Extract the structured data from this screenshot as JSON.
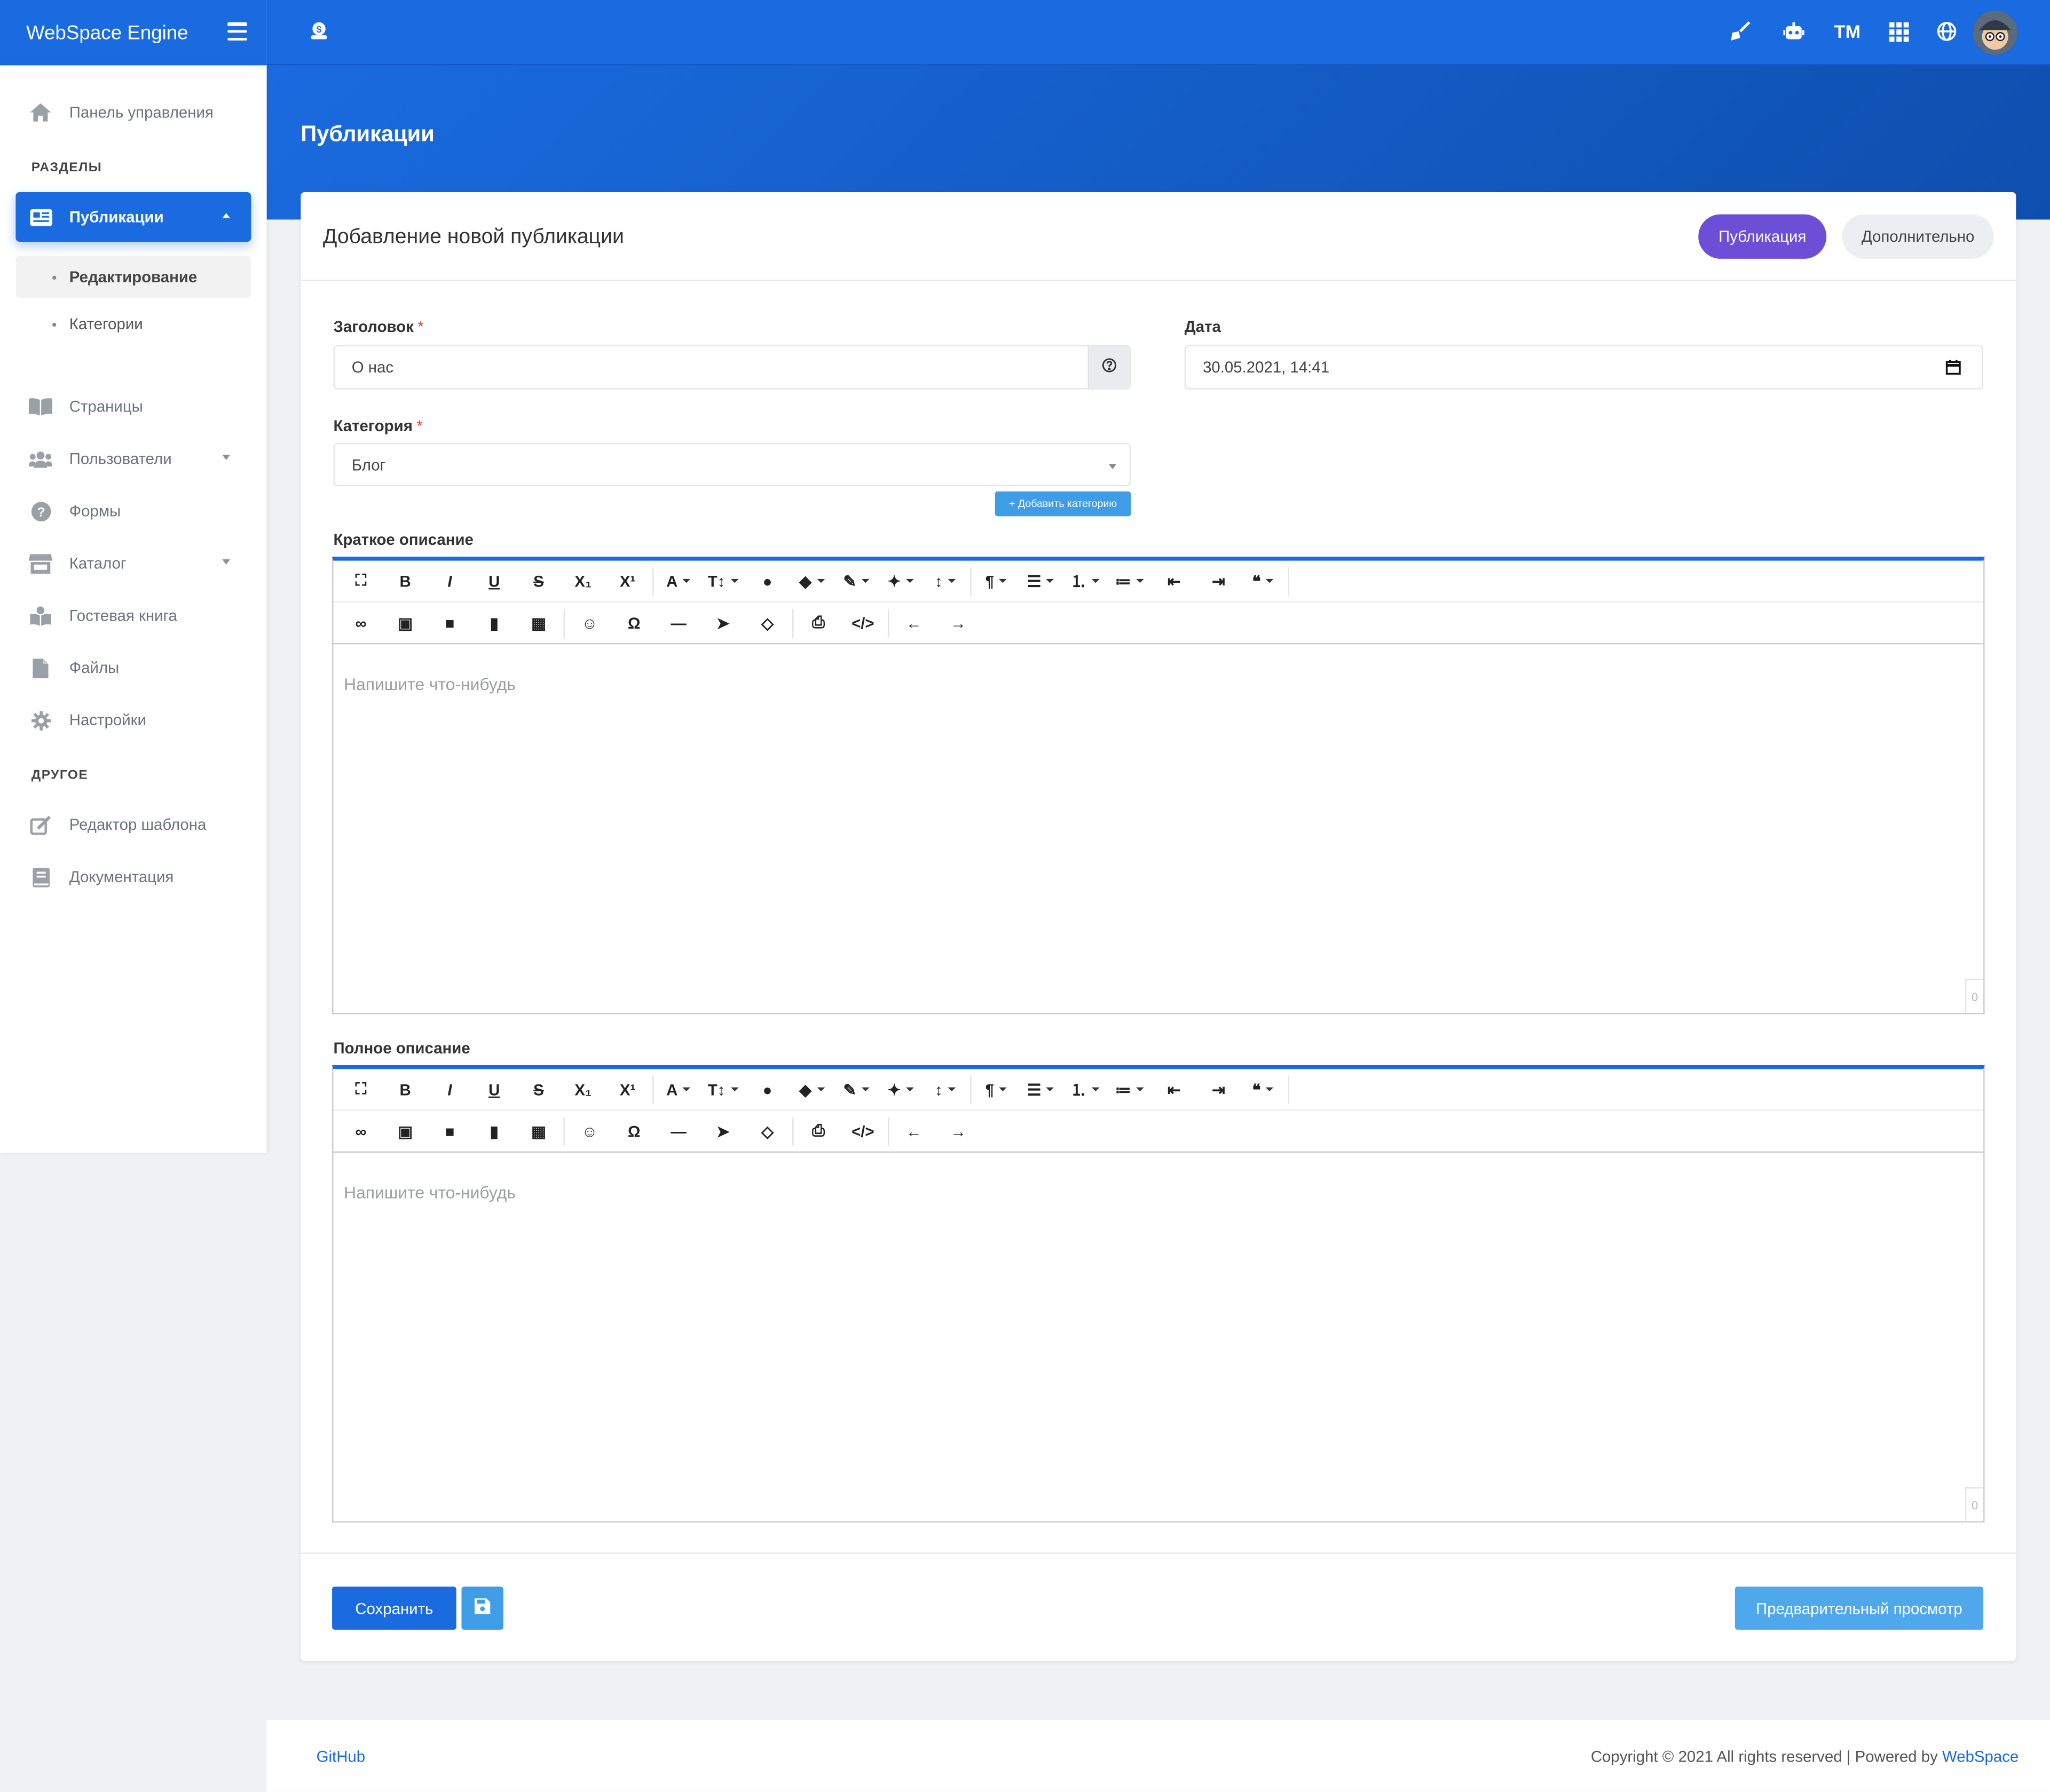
{
  "app": {
    "brand": "WebSpace Engine"
  },
  "topbar": {
    "tm_label": "TM"
  },
  "sidebar": {
    "dashboard": "Панель управления",
    "section_razdely": "РАЗДЕЛЫ",
    "publications": "Публикации",
    "sub_edit": "Редактирование",
    "sub_categories": "Категории",
    "pages": "Страницы",
    "users": "Пользователи",
    "forms": "Формы",
    "catalog": "Каталог",
    "guestbook": "Гостевая книга",
    "files": "Файлы",
    "settings": "Настройки",
    "section_other": "ДРУГОЕ",
    "template_editor": "Редактор шаблона",
    "documentation": "Документация"
  },
  "page": {
    "title": "Публикации"
  },
  "card": {
    "title": "Добавление новой публикации",
    "tab_publication": "Публикация",
    "tab_additional": "Дополнительно"
  },
  "form": {
    "title_label": "Заголовок",
    "title_value": "О нас",
    "date_label": "Дата",
    "date_value": "30.05.2021, 14:41",
    "category_label": "Категория",
    "category_value": "Блог",
    "add_category": "+ Добавить категорию",
    "short_label": "Краткое описание",
    "full_label": "Полное описание",
    "editor_placeholder": "Напишите что-нибудь",
    "counter": "0",
    "required_mark": "*"
  },
  "actions": {
    "save": "Сохранить",
    "preview": "Предварительный просмотр"
  },
  "footer": {
    "github": "GitHub",
    "copyright": "Copyright © 2021 All rights reserved | Powered by ",
    "powered": "WebSpace"
  },
  "toolbar_icons": {
    "row1": [
      "expand-icon",
      "bold-icon",
      "italic-icon",
      "underline-icon",
      "strikethrough-icon",
      "subscript-icon",
      "superscript-icon",
      "font-color-icon",
      "font-size-icon",
      "fill-icon",
      "tag-icon",
      "brush-icon",
      "magic-icon",
      "line-height-icon",
      "paragraph-icon",
      "align-icon",
      "ordered-list-icon",
      "unordered-list-icon",
      "outdent-icon",
      "indent-icon",
      "quote-icon"
    ],
    "row2": [
      "link-icon",
      "image-icon",
      "video-icon",
      "file-icon",
      "table-icon",
      "emoji-icon",
      "omega-icon",
      "hr-icon",
      "select-icon",
      "eraser-icon",
      "print-icon",
      "code-icon",
      "undo-icon",
      "redo-icon"
    ]
  },
  "colors": {
    "primary": "#1a6be0",
    "accent_purple": "#6c4fd6",
    "light_blue": "#4fa8ec"
  }
}
